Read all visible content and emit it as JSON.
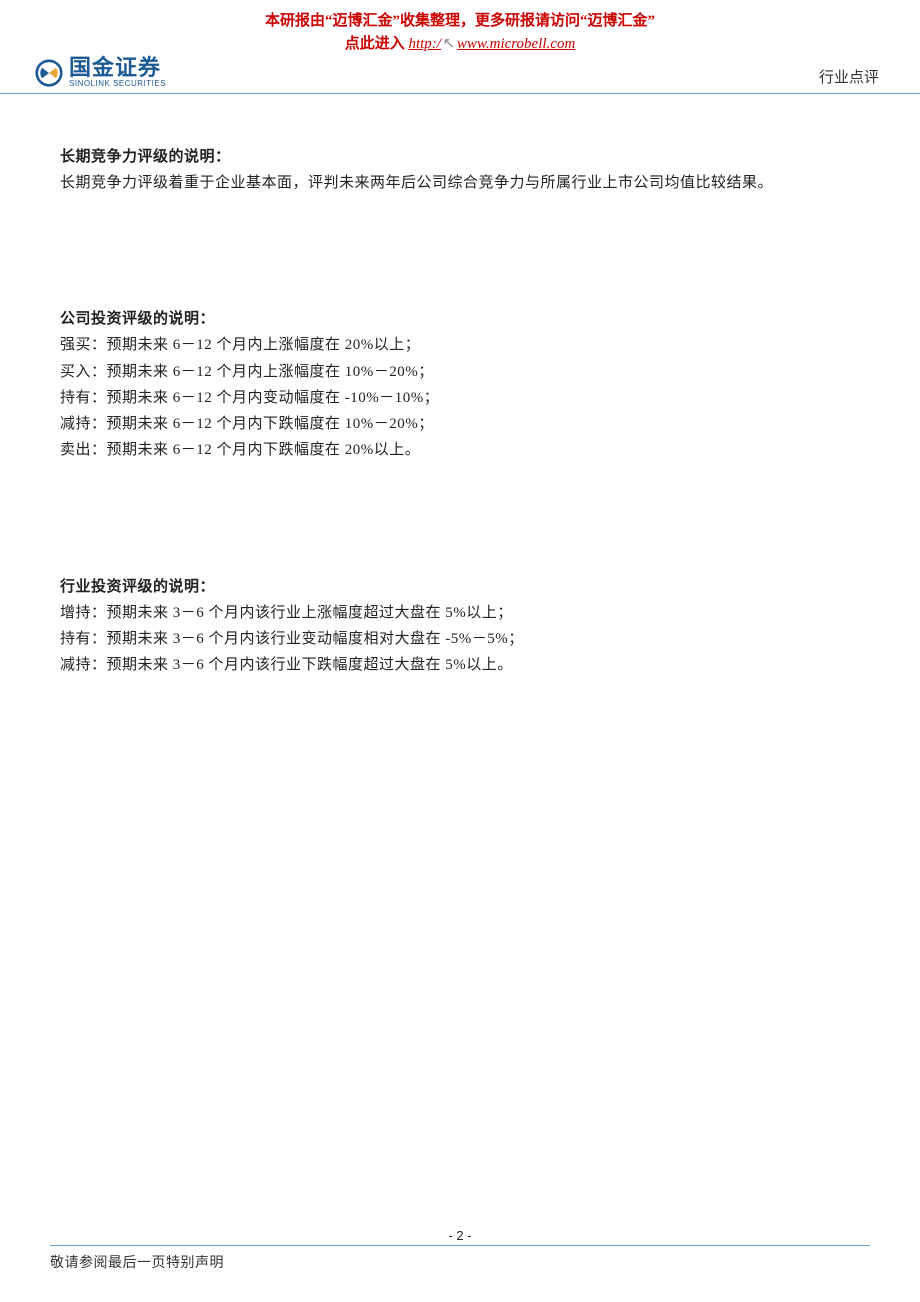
{
  "banner": {
    "line1": "本研报由“迈博汇金”收集整理，更多研报请访问“迈博汇金”",
    "prefix": "点此进入  ",
    "url_before": "http:/",
    "url_after": "www.microbell.com"
  },
  "header": {
    "logo_cn": "国金证券",
    "logo_en": "SINOLINK SECURITIES",
    "right_label": "行业点评"
  },
  "sections": {
    "longterm": {
      "title": "长期竞争力评级的说明：",
      "body": "长期竞争力评级着重于企业基本面，评判未来两年后公司综合竞争力与所属行业上市公司均值比较结果。"
    },
    "company": {
      "title": "公司投资评级的说明：",
      "items": [
        "强买：预期未来 6－12 个月内上涨幅度在 20%以上；",
        "买入：预期未来 6－12 个月内上涨幅度在 10%－20%；",
        "持有：预期未来 6－12 个月内变动幅度在 -10%－10%；",
        "减持：预期未来 6－12 个月内下跌幅度在 10%－20%；",
        "卖出：预期未来 6－12 个月内下跌幅度在 20%以上。"
      ]
    },
    "industry": {
      "title": "行业投资评级的说明：",
      "items": [
        "增持：预期未来 3－6 个月内该行业上涨幅度超过大盘在 5%以上；",
        "持有：预期未来 3－6 个月内该行业变动幅度相对大盘在 -5%－5%；",
        "减持：预期未来 3－6 个月内该行业下跌幅度超过大盘在 5%以上。"
      ]
    }
  },
  "footer": {
    "page": "- 2 -",
    "disclaimer": "敬请参阅最后一页特别声明"
  }
}
